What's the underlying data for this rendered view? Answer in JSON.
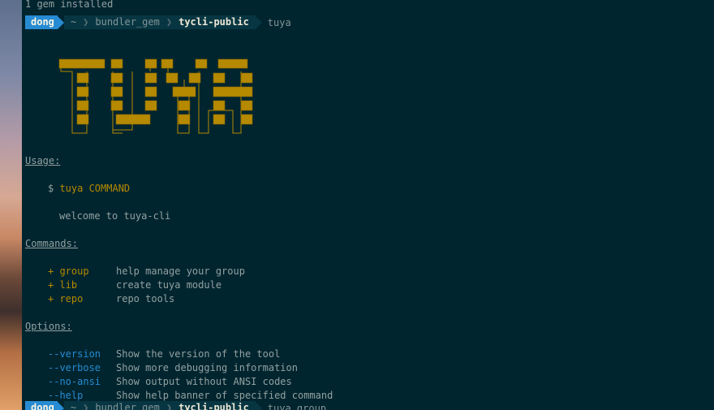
{
  "terminal": {
    "top_line": "1 gem installed",
    "prompt1": {
      "user": "dong",
      "path": [
        "~",
        "bundler_gem",
        "tycli-public"
      ],
      "command": "tuya"
    },
    "usage": {
      "header": "Usage:",
      "command_prefix": "$ ",
      "command": "tuya COMMAND",
      "description": "welcome to tuya-cli"
    },
    "commands": {
      "header": "Commands:",
      "items": [
        {
          "name": "+ group",
          "desc": "help manage your group"
        },
        {
          "name": "+ lib",
          "desc": "create tuya module"
        },
        {
          "name": "+ repo",
          "desc": "repo tools"
        }
      ]
    },
    "options": {
      "header": "Options:",
      "items": [
        {
          "name": "--version",
          "desc": "Show the version of the tool"
        },
        {
          "name": "--verbose",
          "desc": "Show more debugging information"
        },
        {
          "name": "--no-ansi",
          "desc": "Show output without ANSI codes"
        },
        {
          "name": "--help",
          "desc": "Show help banner of specified command"
        }
      ]
    },
    "prompt2": {
      "user": "dong",
      "path": [
        "~",
        "bundler_gem",
        "tycli-public"
      ],
      "command": "tuya group"
    }
  },
  "colors": {
    "background": "#00252f",
    "text": "#93a1a1",
    "yellow": "#b58900",
    "blue": "#268bd2"
  },
  "logo": {
    "text": "TUYA"
  }
}
